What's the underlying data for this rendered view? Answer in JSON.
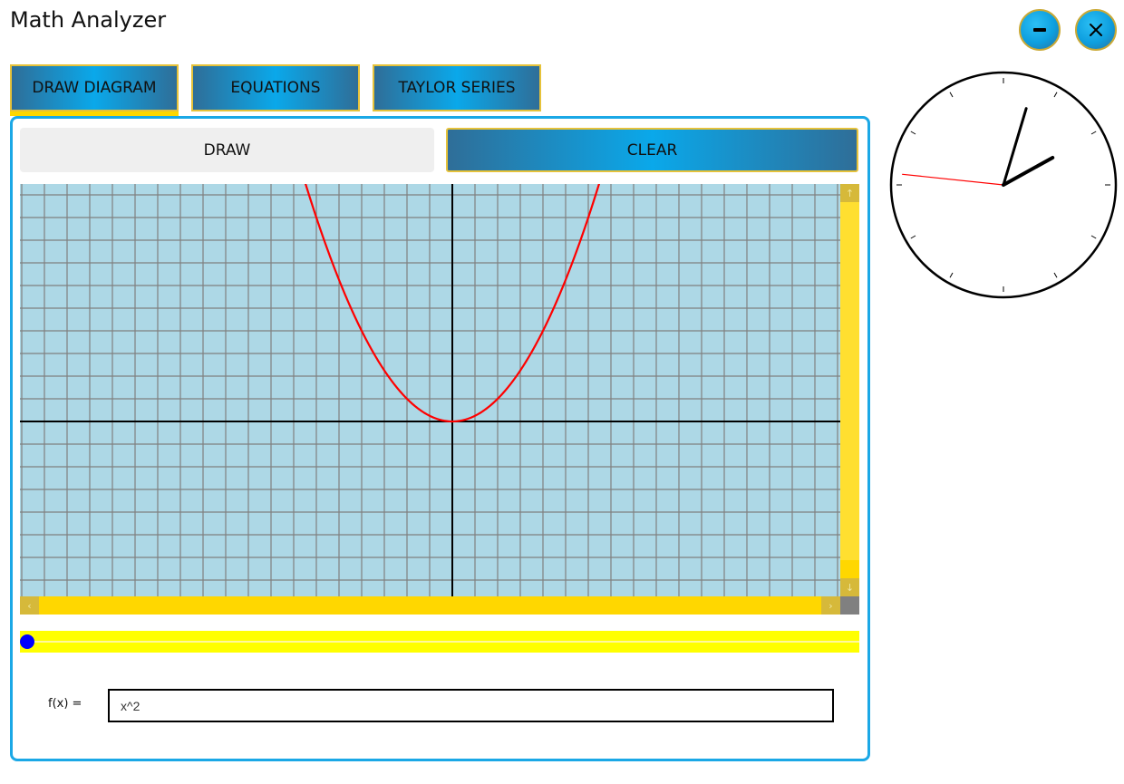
{
  "app": {
    "title": "Math Analyzer"
  },
  "window_controls": {
    "minimize_icon": "minus-icon",
    "close_icon": "close-icon",
    "accent": "#0e9fdf"
  },
  "tabs": [
    {
      "label": "DRAW DIAGRAM",
      "active": true
    },
    {
      "label": "EQUATIONS",
      "active": false
    },
    {
      "label": "TAYLOR SERIES",
      "active": false
    }
  ],
  "actions": {
    "draw_label": "DRAW",
    "clear_label": "CLEAR"
  },
  "graph": {
    "background": "#add8e6",
    "grid_color": "#808080",
    "curve_color": "#ff0000",
    "function": "x^2",
    "grid_on": true
  },
  "slider": {
    "value": 0,
    "track_color": "#ffff00",
    "thumb_color": "#0000ff"
  },
  "function_input": {
    "label": "f(x) =",
    "value": "x^2"
  },
  "clock": {
    "hour": 2,
    "minute": 2,
    "second": 46
  }
}
